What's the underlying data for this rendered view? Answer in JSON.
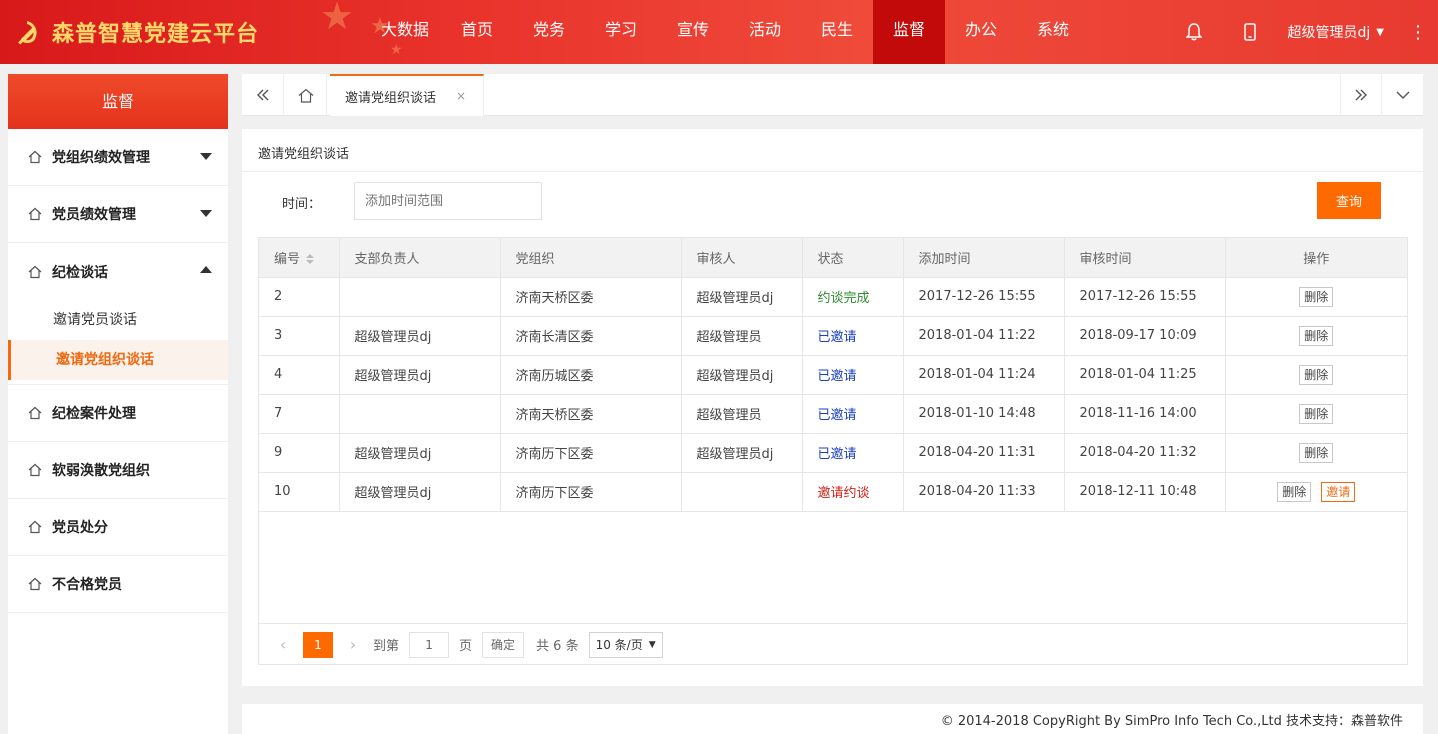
{
  "header": {
    "title": "森普智慧党建云平台",
    "nav": [
      "大数据",
      "首页",
      "党务",
      "学习",
      "宣传",
      "活动",
      "民生",
      "监督",
      "办公",
      "系统"
    ],
    "active_nav": "监督",
    "user": "超级管理员dj",
    "icons": [
      "bell-icon",
      "mobile-icon",
      "more-icon"
    ]
  },
  "sidebar": {
    "title": "监督",
    "items": [
      {
        "label": "党组织绩效管理",
        "arrow": "down"
      },
      {
        "label": "党员绩效管理",
        "arrow": "down"
      },
      {
        "label": "纪检谈话",
        "arrow": "up"
      },
      {
        "label": "纪检案件处理"
      },
      {
        "label": "软弱涣散党组织"
      },
      {
        "label": "党员处分"
      },
      {
        "label": "不合格党员"
      }
    ],
    "subitems": [
      "邀请党员谈话",
      "邀请党组织谈话"
    ],
    "active_sub": "邀请党组织谈话"
  },
  "tabs": {
    "current": "邀请党组织谈话",
    "close": "×"
  },
  "panel": {
    "title": "邀请党组织谈话",
    "filter_label": "时间：",
    "filter_placeholder": "添加时间范围",
    "query_label": "查询"
  },
  "table": {
    "headers": [
      "编号",
      "支部负责人",
      "党组织",
      "审核人",
      "状态",
      "添加时间",
      "审核时间",
      "操作"
    ],
    "rows": [
      {
        "id": "2",
        "leader": "",
        "org": "济南天桥区委",
        "reviewer": "超级管理员dj",
        "status": "约谈完成",
        "status_type": "done",
        "added": "2017-12-26 15:55",
        "reviewed": "2017-12-26 15:55",
        "actions": [
          "删除"
        ]
      },
      {
        "id": "3",
        "leader": "超级管理员dj",
        "org": "济南长清区委",
        "reviewer": "超级管理员",
        "status": "已邀请",
        "status_type": "inv",
        "added": "2018-01-04 11:22",
        "reviewed": "2018-09-17 10:09",
        "actions": [
          "删除"
        ]
      },
      {
        "id": "4",
        "leader": "超级管理员dj",
        "org": "济南历城区委",
        "reviewer": "超级管理员dj",
        "status": "已邀请",
        "status_type": "inv",
        "added": "2018-01-04 11:24",
        "reviewed": "2018-01-04 11:25",
        "actions": [
          "删除"
        ]
      },
      {
        "id": "7",
        "leader": "",
        "org": "济南天桥区委",
        "reviewer": "超级管理员",
        "status": "已邀请",
        "status_type": "inv",
        "added": "2018-01-10 14:48",
        "reviewed": "2018-11-16 14:00",
        "actions": [
          "删除"
        ]
      },
      {
        "id": "9",
        "leader": "超级管理员dj",
        "org": "济南历下区委",
        "reviewer": "超级管理员dj",
        "status": "已邀请",
        "status_type": "inv",
        "added": "2018-04-20 11:31",
        "reviewed": "2018-04-20 11:32",
        "actions": [
          "删除"
        ]
      },
      {
        "id": "10",
        "leader": "超级管理员dj",
        "org": "济南历下区委",
        "reviewer": "",
        "status": "邀请约谈",
        "status_type": "red",
        "added": "2018-04-20 11:33",
        "reviewed": "2018-12-11 10:48",
        "actions": [
          "删除",
          "邀请"
        ]
      }
    ],
    "colors": {
      "done": "#2e8b2e",
      "inv": "#1a3fbf",
      "red": "#d0201a"
    }
  },
  "pager": {
    "current_page": "1",
    "goto_label": "到第",
    "goto_value": "1",
    "page_label": "页",
    "ok_label": "确定",
    "total_label": "共 6 条",
    "page_size": "10 条/页"
  },
  "footer": {
    "text": "© 2014-2018 CopyRight By SimPro Info Tech Co.,Ltd 技术支持：森普软件"
  },
  "colors": {
    "brand_red": "#e4321c",
    "accent_orange": "#ff6a00"
  }
}
